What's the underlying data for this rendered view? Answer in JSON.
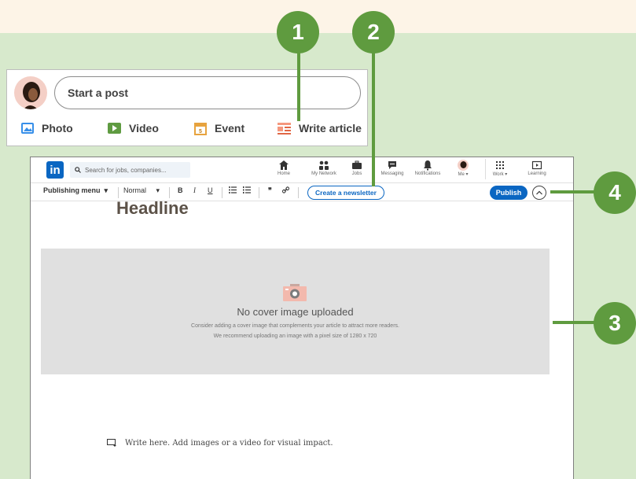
{
  "callouts": [
    "1",
    "2",
    "3",
    "4"
  ],
  "post_box": {
    "start_post": "Start a post",
    "actions": [
      {
        "label": "Photo",
        "icon": "photo-icon"
      },
      {
        "label": "Video",
        "icon": "video-icon"
      },
      {
        "label": "Event",
        "icon": "calendar-icon"
      },
      {
        "label": "Write article",
        "icon": "article-icon"
      }
    ]
  },
  "navbar": {
    "search_placeholder": "Search for jobs, companies...",
    "items": [
      {
        "label": "Home",
        "icon": "home-icon"
      },
      {
        "label": "My Network",
        "icon": "network-icon"
      },
      {
        "label": "Jobs",
        "icon": "briefcase-icon"
      },
      {
        "label": "Messaging",
        "icon": "chat-icon"
      },
      {
        "label": "Notifications",
        "icon": "bell-icon"
      },
      {
        "label": "Me",
        "icon": "avatar"
      },
      {
        "label": "Work",
        "icon": "grid-icon"
      },
      {
        "label": "Learning",
        "icon": "play-icon"
      }
    ]
  },
  "toolbar": {
    "publishing_menu": "Publishing menu",
    "style": "Normal",
    "bold": "B",
    "italic": "I",
    "underline": "U",
    "quote": "❞",
    "newsletter": "Create a newsletter",
    "publish": "Publish"
  },
  "article": {
    "headline": "Headline",
    "cover_title": "No cover image uploaded",
    "cover_line1": "Consider adding a cover image that complements your article to attract more readers.",
    "cover_line2": "We recommend uploading an image with a pixel size of 1280 x 720",
    "write_prompt": "Write here. Add images or a video for visual impact."
  },
  "colors": {
    "brand": "#0a66c2",
    "callout": "#5f9b3f",
    "background": "#d7e9cc"
  }
}
